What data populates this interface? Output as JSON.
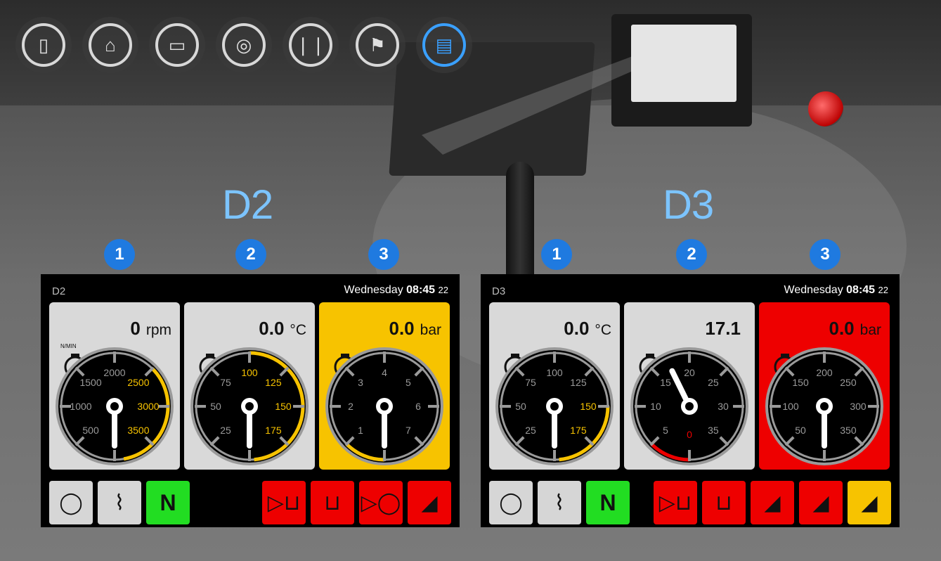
{
  "toolbar": {
    "icons": [
      {
        "name": "door-icon",
        "glyph": "▯",
        "active": false
      },
      {
        "name": "wiper-icon",
        "glyph": "⌂",
        "active": false
      },
      {
        "name": "window-icon",
        "glyph": "▭",
        "active": false
      },
      {
        "name": "key-icon",
        "glyph": "◎",
        "active": false
      },
      {
        "name": "pedals-icon",
        "glyph": "❘❘",
        "active": false
      },
      {
        "name": "traffic-light-icon",
        "glyph": "⚑",
        "active": false
      },
      {
        "name": "display-icon",
        "glyph": "▤",
        "active": true
      }
    ]
  },
  "labels": {
    "d2": "D2",
    "d3": "D3"
  },
  "markers": [
    "1",
    "2",
    "3"
  ],
  "panels": {
    "d2": {
      "title": "D2",
      "date": {
        "day": "Wednesday",
        "time": "08:45",
        "sec": "22"
      },
      "gauges": [
        {
          "icon": "engine-icon",
          "value": "0",
          "unit": "rpm",
          "sub": "N/MIN",
          "bg": "grey",
          "ticks": [
            "500",
            "1000",
            "1500",
            "2000",
            "2500",
            "3000",
            "3500",
            "0"
          ],
          "hi": [
            4,
            5,
            6
          ],
          "needle": 0.0,
          "arc": "yellow-right"
        },
        {
          "icon": "coolant-temp-icon",
          "value": "0.0",
          "unit": "°C",
          "bg": "grey",
          "ticks": [
            "25",
            "50",
            "75",
            "100",
            "125",
            "150",
            "175",
            "0"
          ],
          "hi": [
            3,
            4,
            5,
            6
          ],
          "needle": 0.0,
          "arc": "yellow-top-right"
        },
        {
          "icon": "oil-pressure-icon",
          "value": "0.0",
          "unit": "bar",
          "bg": "yellow",
          "ticks": [
            "1",
            "2",
            "3",
            "4",
            "5",
            "6",
            "7",
            "0"
          ],
          "hi": [
            7
          ],
          "needle": 0.0,
          "arc": "none"
        }
      ],
      "buttons": [
        {
          "name": "engine-status-icon",
          "color": "grey",
          "glyph": "◯"
        },
        {
          "name": "operator-seat-icon",
          "color": "grey",
          "glyph": "⌇"
        },
        {
          "name": "neutral-indicator",
          "color": "green",
          "glyph": "N"
        },
        {
          "name": "hydraulic-filter-icon",
          "color": "red",
          "glyph": "▷⊔"
        },
        {
          "name": "fuel-filter-icon",
          "color": "red",
          "glyph": "⊔"
        },
        {
          "name": "oil-level-icon",
          "color": "red",
          "glyph": "▷◯"
        },
        {
          "name": "pedal-warning-icon",
          "color": "red",
          "glyph": "◢"
        }
      ]
    },
    "d3": {
      "title": "D3",
      "date": {
        "day": "Wednesday",
        "time": "08:45",
        "sec": "22"
      },
      "gauges": [
        {
          "icon": "transmission-temp-icon",
          "value": "0.0",
          "unit": "°C",
          "bg": "grey",
          "ticks": [
            "25",
            "50",
            "75",
            "100",
            "125",
            "150",
            "175",
            "0"
          ],
          "hi": [
            5,
            6
          ],
          "needle": 0.0,
          "arc": "yellow-right-low"
        },
        {
          "icon": "transmission-pressure-icon",
          "value": "17.1",
          "unit": "",
          "bg": "grey",
          "ticks": [
            "5",
            "10",
            "15",
            "20",
            "25",
            "30",
            "35",
            "0"
          ],
          "hi": [],
          "red": [
            7
          ],
          "needle": 17.1,
          "max": 40,
          "arc": "red-bottom"
        },
        {
          "icon": "brake-pressure-icon",
          "value": "0.0",
          "unit": "bar",
          "bg": "red",
          "ticks": [
            "50",
            "100",
            "150",
            "200",
            "250",
            "300",
            "350",
            "0"
          ],
          "hi": [],
          "needle": 0.0,
          "arc": "none"
        }
      ],
      "buttons": [
        {
          "name": "engine-status-icon",
          "color": "grey",
          "glyph": "◯"
        },
        {
          "name": "operator-seat-icon",
          "color": "grey",
          "glyph": "⌇"
        },
        {
          "name": "neutral-indicator",
          "color": "green",
          "glyph": "N"
        },
        {
          "name": "hydraulic-filter-icon",
          "color": "red",
          "glyph": "▷⊔"
        },
        {
          "name": "fuel-filter-icon",
          "color": "red",
          "glyph": "⊔"
        },
        {
          "name": "pedal-warning-icon",
          "color": "red",
          "glyph": "◢"
        },
        {
          "name": "pedal-warning-icon-2",
          "color": "red",
          "glyph": "◢"
        },
        {
          "name": "pedal-caution-icon",
          "color": "yellow",
          "glyph": "◢"
        }
      ]
    }
  }
}
